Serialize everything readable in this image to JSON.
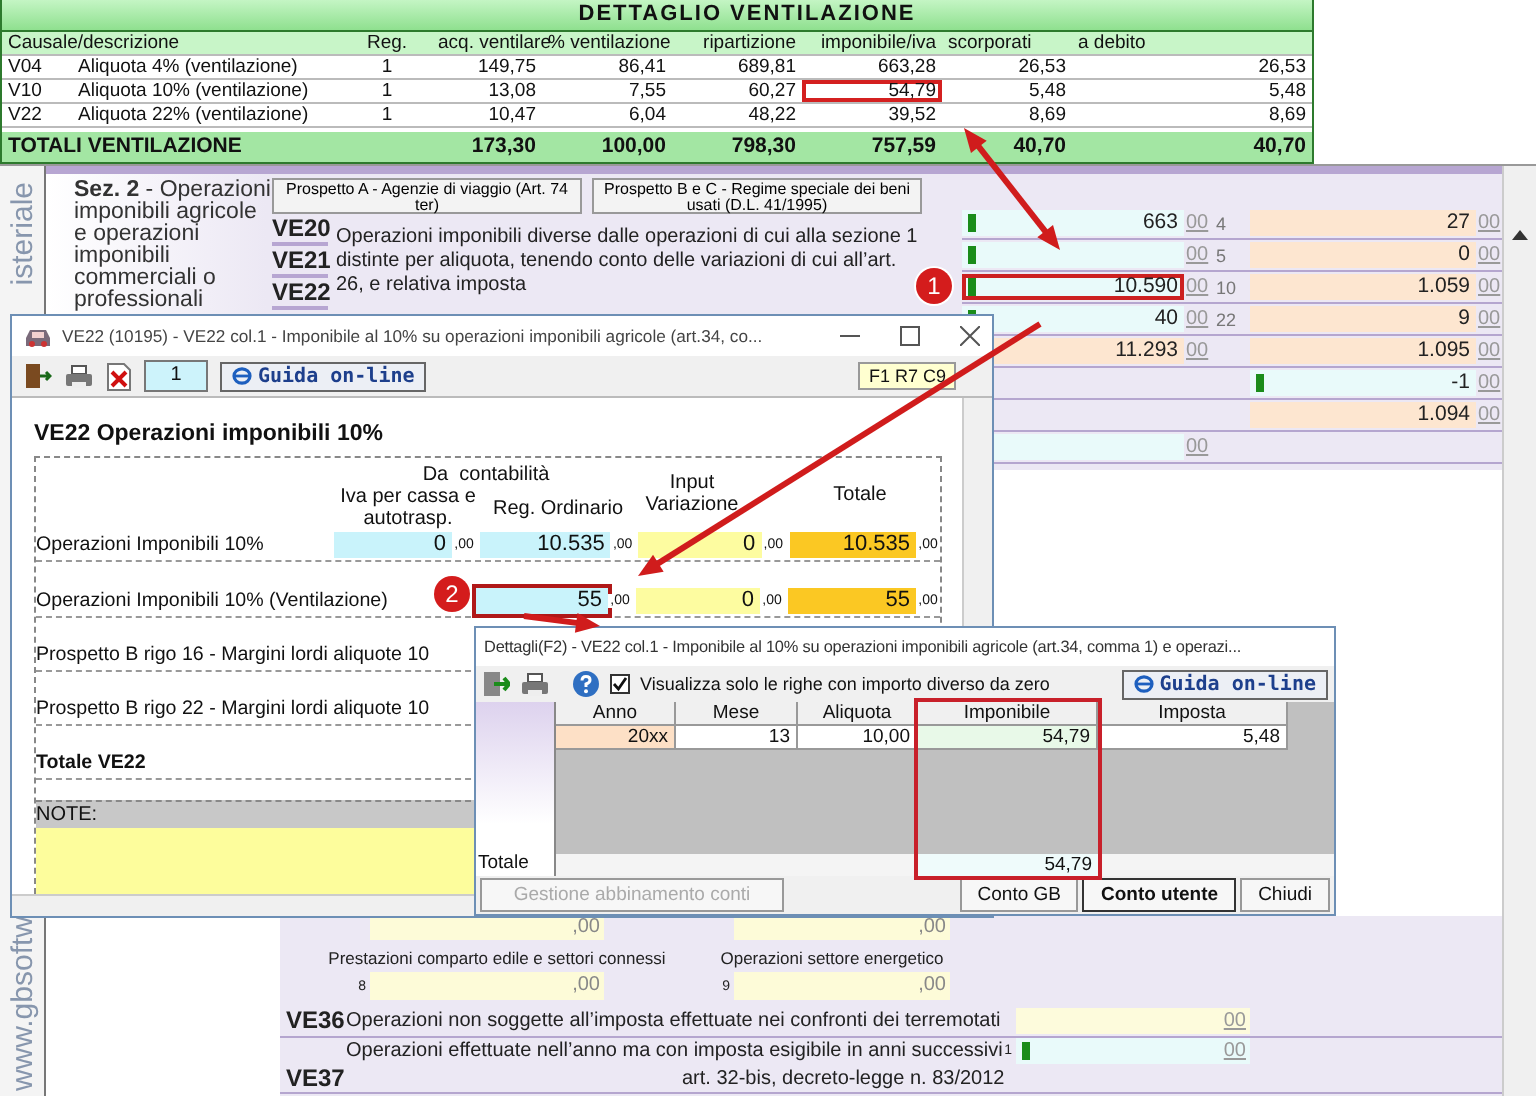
{
  "ventilation": {
    "title": "DETTAGLIO VENTILAZIONE",
    "description_header": "Causale/descrizione",
    "columns": [
      "Reg.",
      "acq. ventilare",
      "% ventilazione",
      "ripartizione",
      "imponibile/iva",
      "scorporati",
      "a debito"
    ],
    "rows": [
      {
        "code": "V04",
        "description": "Aliquota 4% (ventilazione)",
        "cells": [
          "1",
          "149,75",
          "86,41",
          "689,81",
          "663,28",
          "26,53",
          "26,53"
        ],
        "highlighted": false
      },
      {
        "code": "V10",
        "description": "Aliquota 10% (ventilazione)",
        "cells": [
          "1",
          "13,08",
          "7,55",
          "60,27",
          "54,79",
          "5,48",
          "5,48"
        ],
        "highlighted": true
      },
      {
        "code": "V22",
        "description": "Aliquota 22% (ventilazione)",
        "cells": [
          "1",
          "10,47",
          "6,04",
          "48,22",
          "39,52",
          "8,69",
          "8,69"
        ],
        "highlighted": false
      }
    ],
    "total": {
      "label": "TOTALI VENTILAZIONE",
      "cells": [
        "173,30",
        "100,00",
        "798,30",
        "757,59",
        "40,70",
        "40,70"
      ]
    }
  },
  "form": {
    "side_labels": [
      "isteriale",
      "www.gbsoftw"
    ],
    "section": "**Sez. 2** - Operazioni imponibili agricole e operazioni imponibili commerciali o professionali",
    "tabs": [
      "Prospetto A - Agenzie di viaggio (Art. 74 ter)",
      "Prospetto B e C - Regime speciale dei beni usati (D.L. 41/1995)"
    ],
    "codes": [
      "VE20",
      "VE21",
      "VE22"
    ],
    "description": "Operazioni imponibili diverse dalle operazioni di cui alla sezione 1 distinte per aliquota, tenendo conto delle variazioni di cui all’art. 26, e relativa imposta",
    "rows": [
      {
        "left": {
          "kind": "input",
          "value": "663",
          "cents": "00",
          "flag": true
        },
        "rate": "4",
        "right": {
          "kind": "calc",
          "value": "27",
          "cents": "00",
          "flag": false
        },
        "highlighted": false
      },
      {
        "left": {
          "kind": "input",
          "cents": "00",
          "flag": true
        },
        "rate": "5",
        "right": {
          "kind": "calc",
          "value": "0",
          "cents": "00",
          "flag": false
        },
        "highlighted": false
      },
      {
        "left": {
          "kind": "input",
          "value": "10.590",
          "cents": "00",
          "flag": true
        },
        "rate": "10",
        "right": {
          "kind": "calc",
          "value": "1.059",
          "cents": "00",
          "flag": false
        },
        "highlighted": true
      },
      {
        "left": {
          "kind": "input",
          "value": "40",
          "cents": "00",
          "flag": true
        },
        "rate": "22",
        "right": {
          "kind": "calc",
          "value": "9",
          "cents": "00",
          "flag": false
        },
        "highlighted": false
      },
      {
        "left": {
          "kind": "calc",
          "value": "11.293",
          "cents": "00",
          "flag": false
        },
        "right": {
          "kind": "calc",
          "value": "1.095",
          "cents": "00",
          "flag": false
        },
        "highlighted": false
      },
      {
        "right": {
          "kind": "input",
          "value": "-1",
          "cents": "00",
          "flag": true
        },
        "highlighted": false
      },
      {
        "right": {
          "kind": "calc",
          "value": "1.094",
          "cents": "00",
          "flag": false
        },
        "highlighted": false
      },
      {
        "left": {
          "kind": "input",
          "cents": "00",
          "flag": false
        },
        "highlighted": false
      }
    ],
    "lower": {
      "top_fields": [
        {
          "cents": ",00"
        },
        {
          "cents": ",00"
        }
      ],
      "items": [
        {
          "index": "8",
          "label": "Prestazioni comparto edile e settori connessi",
          "cents": ",00"
        },
        {
          "index": "9",
          "label": "Operazioni settore energetico",
          "cents": ",00"
        }
      ],
      "lines": [
        {
          "code": "VE36",
          "text": "Operazioni non soggette all’imposta effettuate nei confronti dei terremotati",
          "field": {
            "kind": "entry",
            "cents": "00",
            "flag": false
          }
        },
        {
          "code": "VE37",
          "text": "Operazioni effettuate nell’anno ma con imposta esigibile in anni successivi",
          "index": "1",
          "field": {
            "kind": "input",
            "cents": "00",
            "flag": true
          },
          "note": "art. 32-bis, decreto-legge n. 83/2012"
        }
      ]
    }
  },
  "entry": {
    "title": "VE22 (10195) - VE22 col.1 - Imponibile al 10% su operazioni imponibili agricole (art.34, co...",
    "page": "1",
    "help": "Guida on-line",
    "cell_ref": "F1 R7 C9",
    "heading": "VE22 Operazioni imponibili 10%",
    "group_header": "Da  contabilità",
    "columns": [
      "Iva per cassa e autotrasp.",
      "Reg. Ordinario",
      "Input Variazione",
      "Totale"
    ],
    "rows": [
      {
        "label": "Operazioni Imponibili 10%",
        "highlighted": false,
        "values": {
          "iva_cassa": {
            "value": "0",
            "cents": ",00"
          },
          "reg_ordinario": {
            "value": "10.535",
            "cents": ",00"
          },
          "input_variazione": {
            "value": "0",
            "cents": ",00"
          },
          "totale": {
            "value": "10.535",
            "cents": ",00"
          }
        }
      },
      {
        "label": "Operazioni Imponibili 10% (Ventilazione)",
        "highlighted": true,
        "values": {
          "reg_ordinario": {
            "value": "55",
            "cents": ",00"
          },
          "input_variazione": {
            "value": "0",
            "cents": ",00"
          },
          "totale": {
            "value": "55",
            "cents": ",00"
          }
        }
      }
    ],
    "extra_rows": [
      "Prospetto B rigo 16 - Margini lordi aliquote 10",
      "Prospetto B rigo 22 - Margini lordi aliquote 10"
    ],
    "total_label": "Totale VE22",
    "note_label": "NOTE:"
  },
  "details": {
    "title": "Dettagli(F2) - VE22 col.1 - Imponibile al 10% su operazioni imponibili agricole (art.34, comma 1) e operazi...",
    "filter": {
      "label": "Visualizza solo le righe con importo diverso da zero",
      "checked": true
    },
    "help": "Guida on-line",
    "columns": [
      {
        "label": "Anno",
        "kind": "key",
        "highlighted": false
      },
      {
        "label": "Mese",
        "kind": "plain",
        "highlighted": false
      },
      {
        "label": "Aliquota",
        "kind": "plain",
        "highlighted": false
      },
      {
        "label": "Imponibile",
        "kind": "base",
        "highlighted": true,
        "total": "54,79"
      },
      {
        "label": "Imposta",
        "kind": "plain",
        "highlighted": false
      }
    ],
    "rows": [
      {
        "cells": [
          "20xx",
          "13",
          "10,00",
          "54,79",
          "5,48"
        ]
      }
    ],
    "total_label": "Totale",
    "buttons": [
      {
        "label": "Gestione abbinamento conti",
        "disabled": true,
        "default": false
      },
      {
        "label": "Conto GB",
        "disabled": false,
        "default": false
      },
      {
        "label": "Conto utente",
        "disabled": false,
        "default": true
      },
      {
        "label": "Chiudi",
        "disabled": false,
        "default": false
      }
    ]
  },
  "callouts": [
    {
      "label": "1"
    },
    {
      "label": "2"
    }
  ]
}
